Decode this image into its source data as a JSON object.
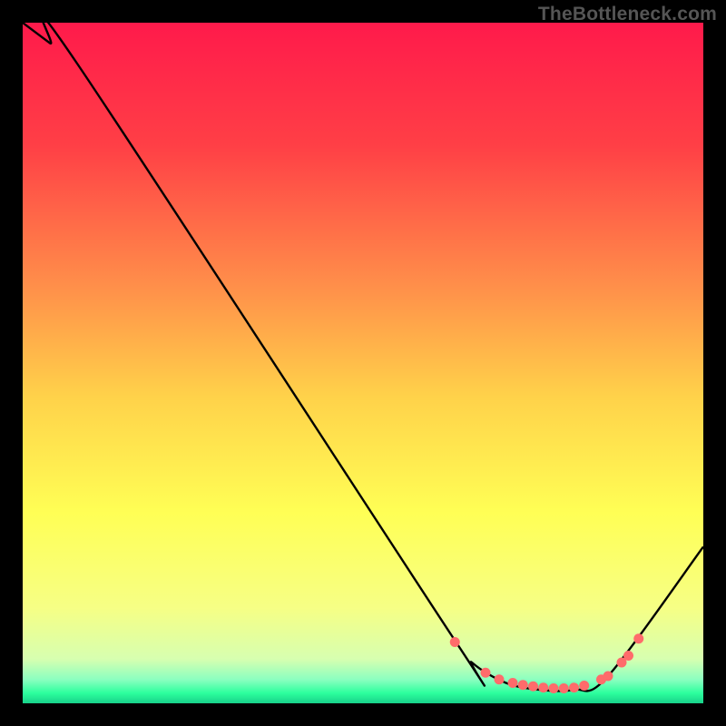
{
  "attribution": "TheBottleneck.com",
  "chart_data": {
    "type": "line",
    "title": "",
    "xlabel": "",
    "ylabel": "",
    "xlim": [
      0,
      100
    ],
    "ylim": [
      0,
      100
    ],
    "gradient_stops": [
      {
        "offset": 0,
        "color": "#ff1a4b"
      },
      {
        "offset": 0.18,
        "color": "#ff3f46"
      },
      {
        "offset": 0.4,
        "color": "#ff944a"
      },
      {
        "offset": 0.55,
        "color": "#ffd24a"
      },
      {
        "offset": 0.72,
        "color": "#ffff55"
      },
      {
        "offset": 0.86,
        "color": "#f6ff85"
      },
      {
        "offset": 0.935,
        "color": "#d7ffb0"
      },
      {
        "offset": 0.965,
        "color": "#8bffc0"
      },
      {
        "offset": 0.985,
        "color": "#2cff9d"
      },
      {
        "offset": 1.0,
        "color": "#18d18a"
      }
    ],
    "series": [
      {
        "name": "curve",
        "x": [
          0,
          4,
          8,
          63,
          66,
          71,
          76,
          81,
          86,
          100
        ],
        "y": [
          100,
          97,
          94,
          10,
          6,
          3,
          2,
          2,
          4,
          23
        ]
      }
    ],
    "markers": {
      "name": "highlight-points",
      "color": "#ff6b6b",
      "x": [
        63.5,
        68,
        70,
        72,
        73.5,
        75,
        76.5,
        78,
        79.5,
        81,
        82.5,
        85,
        86,
        88,
        89,
        90.5
      ],
      "y": [
        9,
        4.5,
        3.5,
        3,
        2.7,
        2.5,
        2.3,
        2.2,
        2.2,
        2.3,
        2.6,
        3.5,
        4,
        6,
        7,
        9.5
      ]
    }
  }
}
